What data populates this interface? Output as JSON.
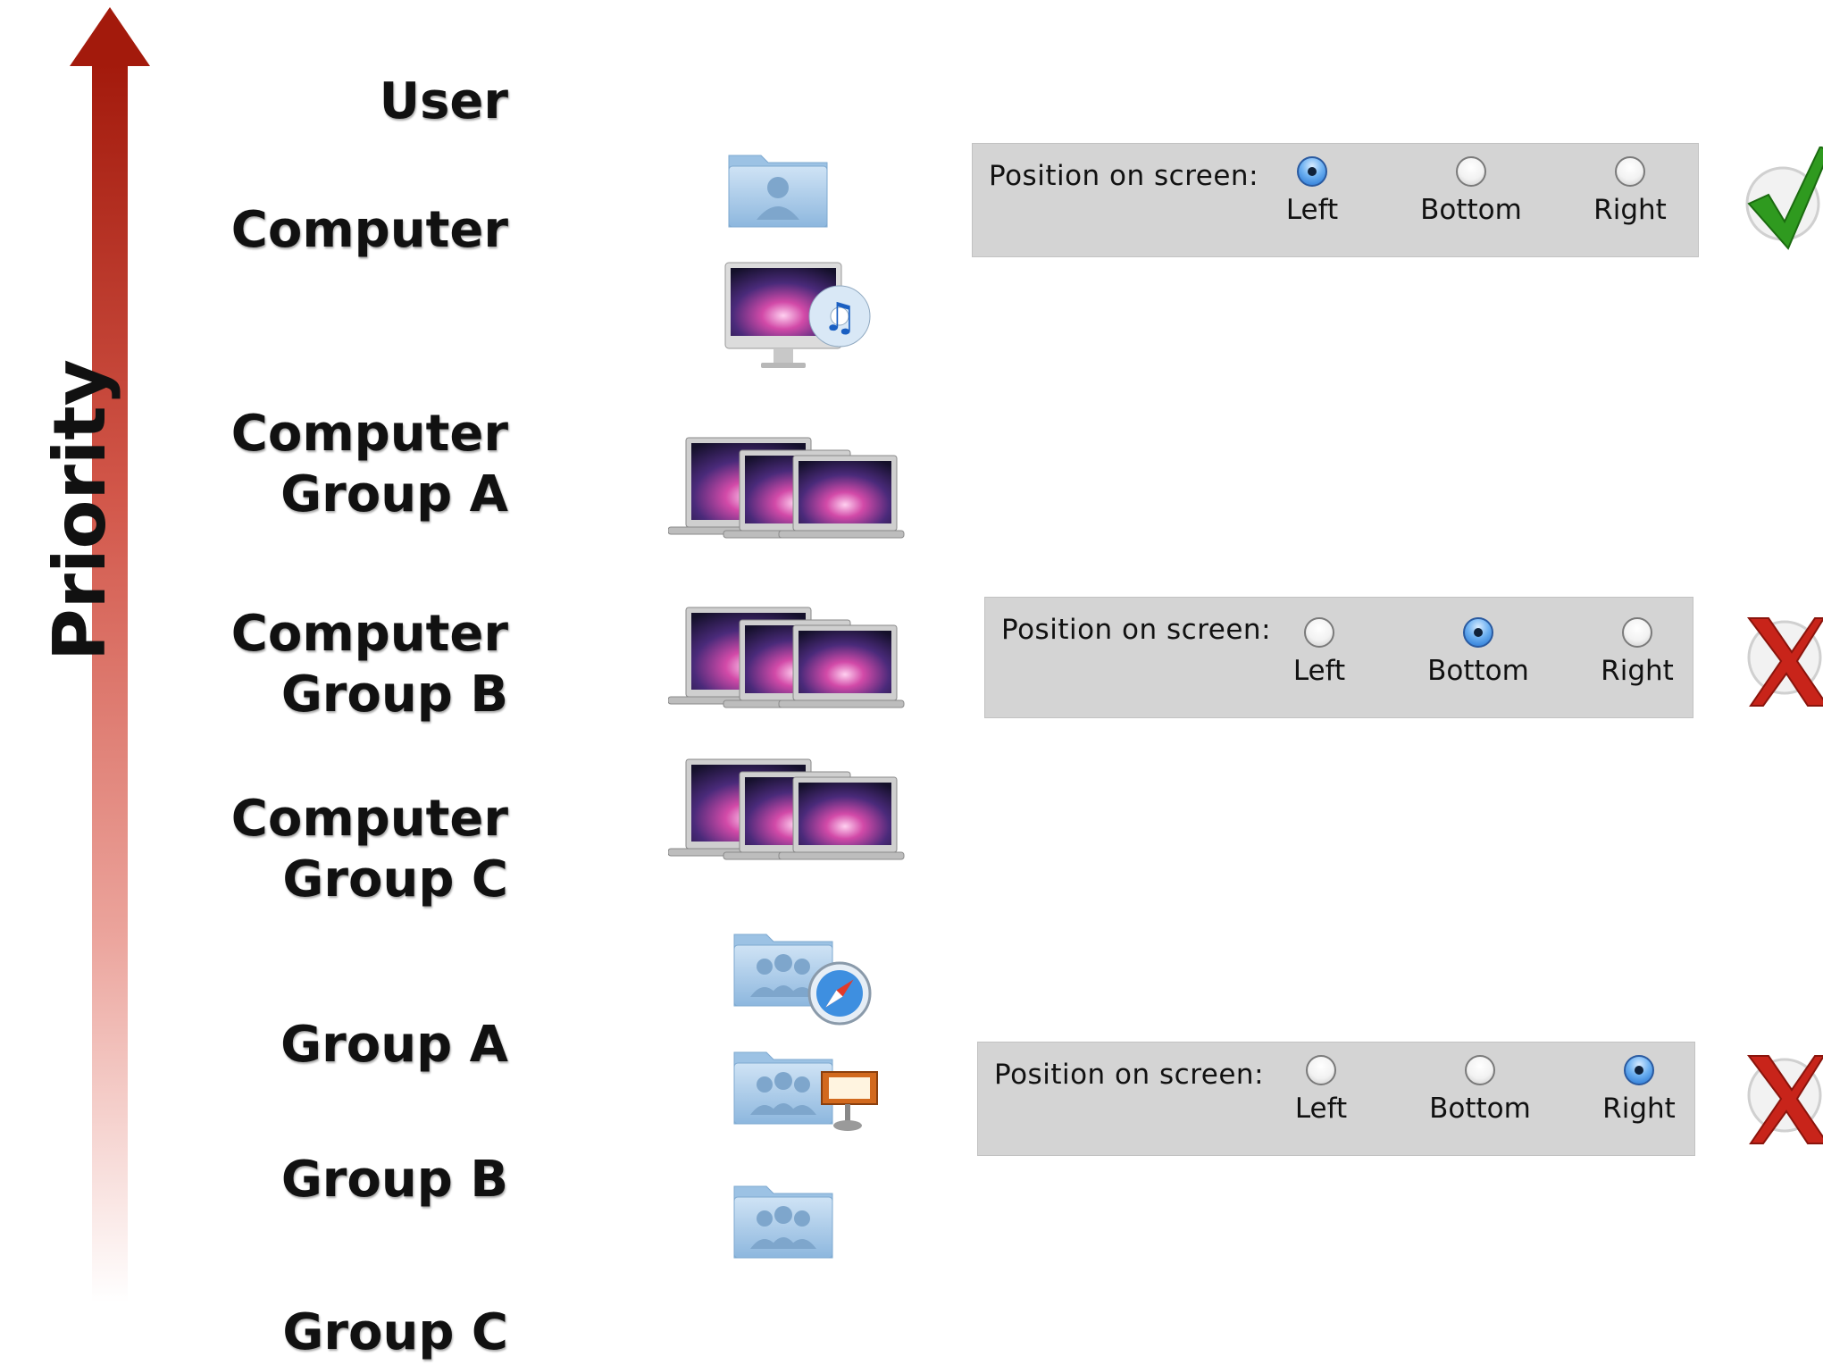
{
  "axis": {
    "label": "Priority",
    "color_top": "#a31a0c",
    "color_bottom": "#ffffff"
  },
  "levels": [
    {
      "lines": [
        "User"
      ]
    },
    {
      "lines": [
        "Computer"
      ]
    },
    {
      "lines": [
        "Computer",
        "Group A"
      ]
    },
    {
      "lines": [
        "Computer",
        "Group B"
      ]
    },
    {
      "lines": [
        "Computer",
        "Group C"
      ]
    },
    {
      "lines": [
        "Group A"
      ]
    },
    {
      "lines": [
        "Group B"
      ]
    },
    {
      "lines": [
        "Group C"
      ]
    }
  ],
  "icons": [
    "user-folder-icon",
    "imac-itunes-icon",
    "computer-group-a-laptops-icon",
    "computer-group-b-laptops-icon",
    "computer-group-c-laptops-icon",
    "group-folder-safari-icon",
    "group-folder-keynote-icon",
    "group-folder-icon"
  ],
  "panels": [
    {
      "label": "Position on screen:",
      "options": [
        "Left",
        "Bottom",
        "Right"
      ],
      "selected": "Left",
      "result": "check"
    },
    {
      "label": "Position on screen:",
      "options": [
        "Left",
        "Bottom",
        "Right"
      ],
      "selected": "Bottom",
      "result": "cross"
    },
    {
      "label": "Position on screen:",
      "options": [
        "Left",
        "Bottom",
        "Right"
      ],
      "selected": "Right",
      "result": "cross"
    }
  ],
  "colors": {
    "check": "#2f9a1f",
    "cross": "#c8241a",
    "panel_bg": "#d4d4d4",
    "radio_selected": "#3b86dc"
  }
}
